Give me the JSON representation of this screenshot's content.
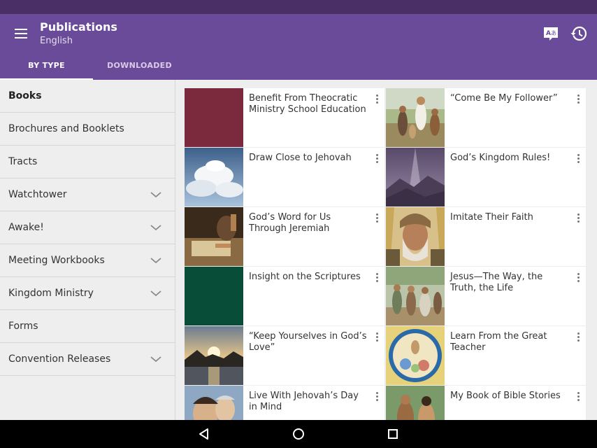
{
  "header": {
    "title": "Publications",
    "subtitle": "English",
    "menu_icon": "hamburger-menu-icon",
    "language_icon": "translate-icon",
    "history_icon": "history-icon"
  },
  "tabs": [
    {
      "label": "BY TYPE",
      "active": true
    },
    {
      "label": "DOWNLOADED",
      "active": false
    }
  ],
  "sidebar": {
    "items": [
      {
        "label": "Books",
        "active": true,
        "expandable": false
      },
      {
        "label": "Brochures and Booklets",
        "active": false,
        "expandable": false
      },
      {
        "label": "Tracts",
        "active": false,
        "expandable": false
      },
      {
        "label": "Watchtower",
        "active": false,
        "expandable": true
      },
      {
        "label": "Awake!",
        "active": false,
        "expandable": true
      },
      {
        "label": "Meeting Workbooks",
        "active": false,
        "expandable": true
      },
      {
        "label": "Kingdom Ministry",
        "active": false,
        "expandable": true
      },
      {
        "label": "Forms",
        "active": false,
        "expandable": false
      },
      {
        "label": "Convention Releases",
        "active": false,
        "expandable": true
      }
    ]
  },
  "publications": [
    {
      "title": "Benefit From Theocratic Ministry School Education",
      "thumb": "maroon-cover"
    },
    {
      "title": "“Come Be My Follower”",
      "thumb": "jesus-crowd-painting"
    },
    {
      "title": "Draw Close to Jehovah",
      "thumb": "sky-clouds-photo"
    },
    {
      "title": "God’s Kingdom Rules!",
      "thumb": "mountains-light-rays"
    },
    {
      "title": "God’s Word for Us Through Jeremiah",
      "thumb": "scribe-writing-painting"
    },
    {
      "title": "Imitate Their Faith",
      "thumb": "bearded-man-portrait"
    },
    {
      "title": "Insight on the Scriptures",
      "thumb": "green-cover"
    },
    {
      "title": "Jesus—The Way, the Truth, the Life",
      "thumb": "jesus-donkey-painting"
    },
    {
      "title": "“Keep Yourselves in God’s Love”",
      "thumb": "sunset-sea-photo"
    },
    {
      "title": "Learn From the Great Teacher",
      "thumb": "round-teacher-illustration"
    },
    {
      "title": "Live With Jehovah’s Day in Mind",
      "thumb": "people-portrait-photo"
    },
    {
      "title": "My Book of Bible Stories",
      "thumb": "bible-stories-painting"
    }
  ],
  "colors": {
    "status_bar": "#4a2f66",
    "app_bar": "#6a4b99",
    "background": "#eeeeee",
    "card": "#ffffff"
  },
  "navigation": {
    "back_icon": "back-triangle-icon",
    "home_icon": "home-circle-icon",
    "recents_icon": "recents-square-icon"
  }
}
